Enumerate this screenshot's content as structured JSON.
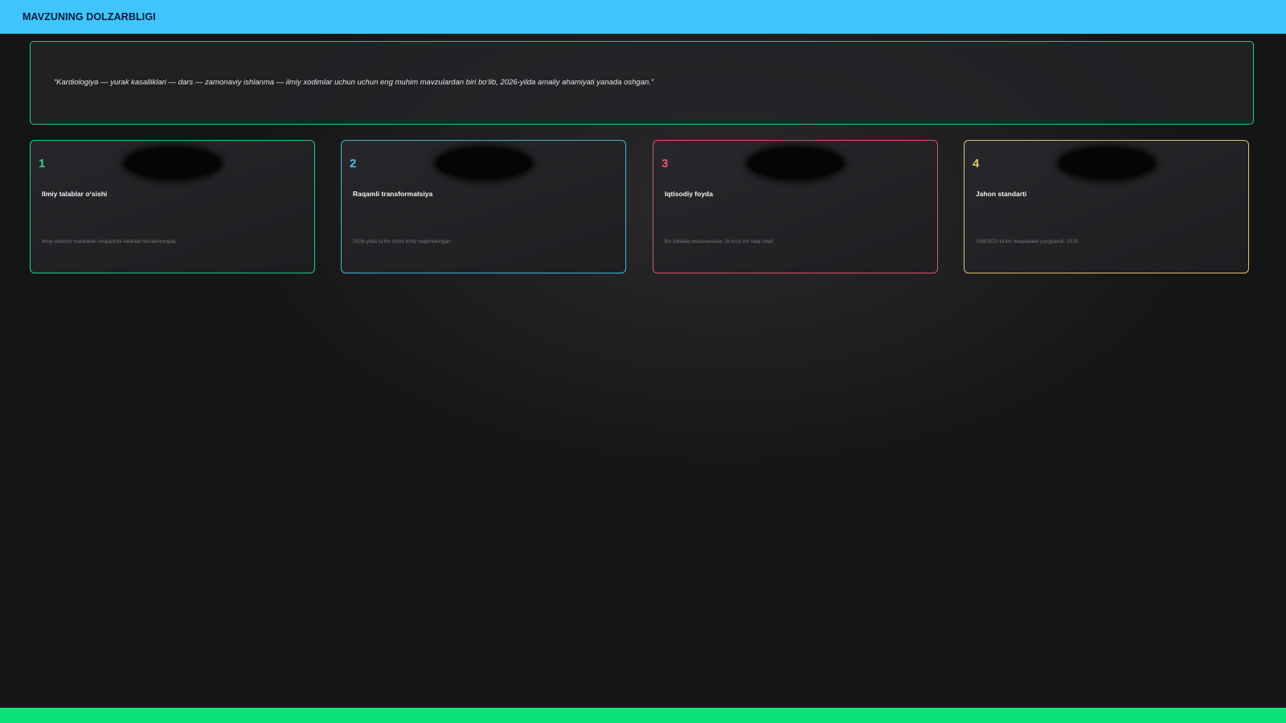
{
  "header": {
    "title": "MAVZUNING DOLZARBLIGI"
  },
  "quote": {
    "text": "“Kardiologiya — yurak kasalliklari — dars — zamonaviy ishlanma — ilmiy xodimlar uchun uchun eng muhim mavzulardan biri bo‘lib, 2026-yilda amaliy ahamiyati yanada oshgan.”"
  },
  "cards": [
    {
      "number": "1",
      "title": "Ilmiy talablar o‘sishi",
      "description": "Ilmiy-axborot manbalari rivojlanishi talablari tezlashmoqda",
      "color": "#1fc98a"
    },
    {
      "number": "2",
      "title": "Raqamli transformatsiya",
      "description": "2026-yilda ta’lim tizimi to‘liq raqamlashgan",
      "color": "#3fb7d3"
    },
    {
      "number": "3",
      "title": "Iqtisodiy foyda",
      "description": "Bu sohada mutaxassislar 3x ko‘p ish haqi oladi",
      "color": "#d9546a"
    },
    {
      "number": "4",
      "title": "Jahon standarti",
      "description": "UNESCO ta’lim maqsadlari yangilandi: 2025",
      "color": "#e2c16c"
    }
  ],
  "colors": {
    "header": "#3fc4fb",
    "footer": "#0ce27a",
    "background": "#151416"
  }
}
